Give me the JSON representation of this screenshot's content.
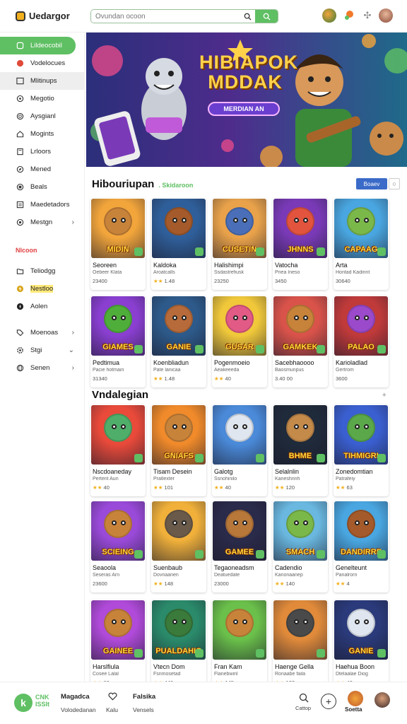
{
  "header": {
    "logo_text": "Uedargor",
    "search_placeholder": "Ovundan ocoon"
  },
  "sidebar": {
    "items": [
      {
        "label": "Lildeocobil"
      },
      {
        "label": "Vodelocues"
      },
      {
        "label": "Mlitinups"
      },
      {
        "label": "Megotio"
      },
      {
        "label": "Aysgianl"
      },
      {
        "label": "Mogints"
      },
      {
        "label": "Lrloors"
      },
      {
        "label": "Mened"
      },
      {
        "label": "Beals"
      },
      {
        "label": "Maedetadors"
      },
      {
        "label": "Mestgn"
      }
    ],
    "section_label": "Nlcoon",
    "items2": [
      {
        "label": "Teliodgg"
      },
      {
        "label": "Nestloo"
      },
      {
        "label": "Aolen"
      }
    ],
    "items3": [
      {
        "label": "Moenoas"
      },
      {
        "label": "Stgi"
      },
      {
        "label": "Senen"
      }
    ]
  },
  "banner": {
    "title_line1": "HIBIAPOK",
    "title_line2": "MDDAK",
    "button_label": "MERDIAN AN"
  },
  "section1": {
    "title": "Hibouriupan",
    "subtitle": ". Skidaroon",
    "view_label": "Boaev"
  },
  "section2": {
    "title": "Vndalegian"
  },
  "cards_row1": [
    {
      "art": "MIDIN",
      "title": "Seoreen",
      "sub": "Oebeer Klata",
      "meta": "23400",
      "rated": false,
      "color": "#f2a53b",
      "face": "#c8833a"
    },
    {
      "art": "",
      "title": "Kaldoka",
      "sub": "Aroatcalls",
      "meta": "1.48",
      "rated": true,
      "color": "#2f5f9a",
      "face": "#a45a2a"
    },
    {
      "art": "CUSETIN",
      "title": "Halishimpi",
      "sub": "Ssdastrefiusk",
      "meta": "23250",
      "rated": false,
      "color": "#e9a24a",
      "face": "#4a6fb8"
    },
    {
      "art": "JHNNS",
      "title": "Vatocha",
      "sub": "Pnea Ineso",
      "meta": "3450",
      "rated": false,
      "color": "#7a3ab8",
      "face": "#e2543e"
    },
    {
      "art": "CAPAAG",
      "title": "Arta",
      "sub": "Hontad Kadinnt",
      "meta": "30640",
      "rated": false,
      "color": "#49a6e0",
      "face": "#7bb84a"
    }
  ],
  "cards_row2": [
    {
      "art": "GIAMES",
      "title": "Pedtimua",
      "sub": "Pacie hotmain",
      "meta": "31340",
      "rated": false,
      "color": "#8a3fd1",
      "face": "#4fae3a"
    },
    {
      "art": "GANIE",
      "title": "Koenbliadun",
      "sub": "Pate lanicaa",
      "meta": "1.48",
      "rated": true,
      "color": "#2d5a8a",
      "face": "#b86b3a"
    },
    {
      "art": "GUSAR",
      "title": "Pogenmoeio",
      "sub": "Aeakeeeda",
      "meta": "40",
      "rated": true,
      "color": "#f0c83a",
      "face": "#e25a86"
    },
    {
      "art": "GAMKEK",
      "title": "Sacebhaoooo",
      "sub": "Baosmunpus",
      "meta": "3.40 00",
      "rated": false,
      "color": "#d9534a",
      "face": "#c8833a"
    },
    {
      "art": "PALAO",
      "title": "Karioladlad",
      "sub": "Gertrom",
      "meta": "3600",
      "rated": false,
      "color": "#c03a3a",
      "face": "#9a4acb"
    }
  ],
  "cards_row3": [
    {
      "art": "",
      "title": "Nscdoaneday",
      "sub": "Pertent Aun",
      "meta": "40",
      "rated": true,
      "color": "#e94a3a",
      "face": "#4fae6a"
    },
    {
      "art": "GNIAFS",
      "title": "Tisam Desein",
      "sub": "Pratlexter",
      "meta": "101",
      "rated": true,
      "color": "#f08a2a",
      "face": "#c8833a"
    },
    {
      "art": "",
      "title": "Galotg",
      "sub": "Ssnohinilo",
      "meta": "40",
      "rated": true,
      "color": "#4a8ad9",
      "face": "#dfe6ef"
    },
    {
      "art": "BHME",
      "title": "Selalnlin",
      "sub": "Kaneshnnh",
      "meta": "120",
      "rated": true,
      "color": "#1f2a3a",
      "face": "#c48a4a"
    },
    {
      "art": "TIHMIGRI",
      "title": "Zonedomtian",
      "sub": "Patrafeiy",
      "meta": "63",
      "rated": true,
      "color": "#3a5fd0",
      "face": "#5aa84a"
    }
  ],
  "cards_row4": [
    {
      "art": "SCIEING",
      "title": "Seaoola",
      "sub": "Seseras Arn",
      "meta": "23600",
      "rated": false,
      "color": "#9a4ad9",
      "face": "#c8833a"
    },
    {
      "art": "",
      "title": "Suenbaub",
      "sub": "Dovnaanen",
      "meta": "148",
      "rated": true,
      "color": "#f0b03a",
      "face": "#6a5a4a"
    },
    {
      "art": "GAMEE",
      "title": "Tegaoneadsm",
      "sub": "Deatuedate",
      "meta": "23000",
      "rated": false,
      "color": "#2a2a4a",
      "face": "#b8783a"
    },
    {
      "art": "SMACH",
      "title": "Cadendio",
      "sub": "Kanonaanep",
      "meta": "140",
      "rated": true,
      "color": "#6ab8e0",
      "face": "#7bb84a"
    },
    {
      "art": "DANDIRRE",
      "title": "Genelteunt",
      "sub": "Panalrorn",
      "meta": "4",
      "rated": true,
      "color": "#49a6e0",
      "face": "#a45a2a"
    }
  ],
  "cards_row5": [
    {
      "art": "GAINEE",
      "title": "Harslfiula",
      "sub": "Cosee Lalal",
      "meta": "60",
      "rated": true,
      "color": "#b04ad9",
      "face": "#c8833a"
    },
    {
      "art": "PUALDAHIO",
      "title": "Vtecn Dom",
      "sub": "Fsnmosetad",
      "meta": "448",
      "rated": true,
      "color": "#2a8a6a",
      "face": "#3a7a3a"
    },
    {
      "art": "",
      "title": "Fran Kam",
      "sub": "Flanebwinl",
      "meta": "145",
      "rated": true,
      "color": "#6ac04a",
      "face": "#c8833a"
    },
    {
      "art": "",
      "title": "Haenge Gella",
      "sub": "Ronaabe faila",
      "meta": "102",
      "rated": true,
      "color": "#e08a3a",
      "face": "#4a4a4a"
    },
    {
      "art": "GANIE",
      "title": "Haehua Boon",
      "sub": "Dtelaalae Diog",
      "meta": "40",
      "rated": true,
      "color": "#2a3a7a",
      "face": "#dfe6ef"
    }
  ],
  "bottom": {
    "logo_letter": "k",
    "brand_line1": "CNK",
    "brand_line2": "ISSIt",
    "nav1_title": "Magadca",
    "nav1_sub": "Volodedanan",
    "nav2_sub": "Kalu",
    "nav3_title": "Falsika",
    "nav3_sub": "Vensels",
    "action1_label": "Cattop",
    "avatar_label": "Soetta"
  },
  "colors": {
    "accent": "#5fbf63",
    "section_red": "#e04040",
    "button_blue": "#3b6bc8"
  }
}
